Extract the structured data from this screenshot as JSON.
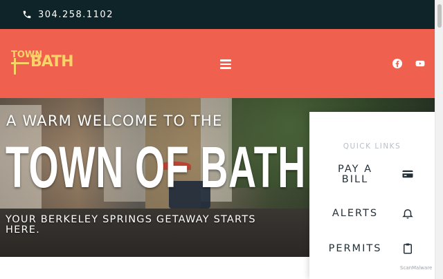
{
  "topbar": {
    "phone": "304.258.1102",
    "icon": "phone-icon"
  },
  "header": {
    "logo_text_top": "TOWN",
    "logo_text_main": "BATH",
    "menu_icon": "hamburger-menu-icon",
    "social": [
      "facebook-icon",
      "youtube-icon"
    ],
    "colors": {
      "header_bg": "#f0604e",
      "topbar_bg": "#0f2428",
      "logo": "#f9d26a"
    }
  },
  "hero": {
    "welcome": "A WARM WELCOME TO THE",
    "title": "TOWN OF BATH",
    "tagline": "YOUR BERKELEY SPRINGS GETAWAY STARTS HERE."
  },
  "quick_links": {
    "heading": "QUICK LINKS",
    "items": [
      {
        "label": "PAY A BILL",
        "icon": "credit-card-icon"
      },
      {
        "label": "ALERTS",
        "icon": "bell-icon"
      },
      {
        "label": "PERMITS",
        "icon": "clipboard-icon"
      }
    ]
  },
  "badge": "ScanMalware"
}
